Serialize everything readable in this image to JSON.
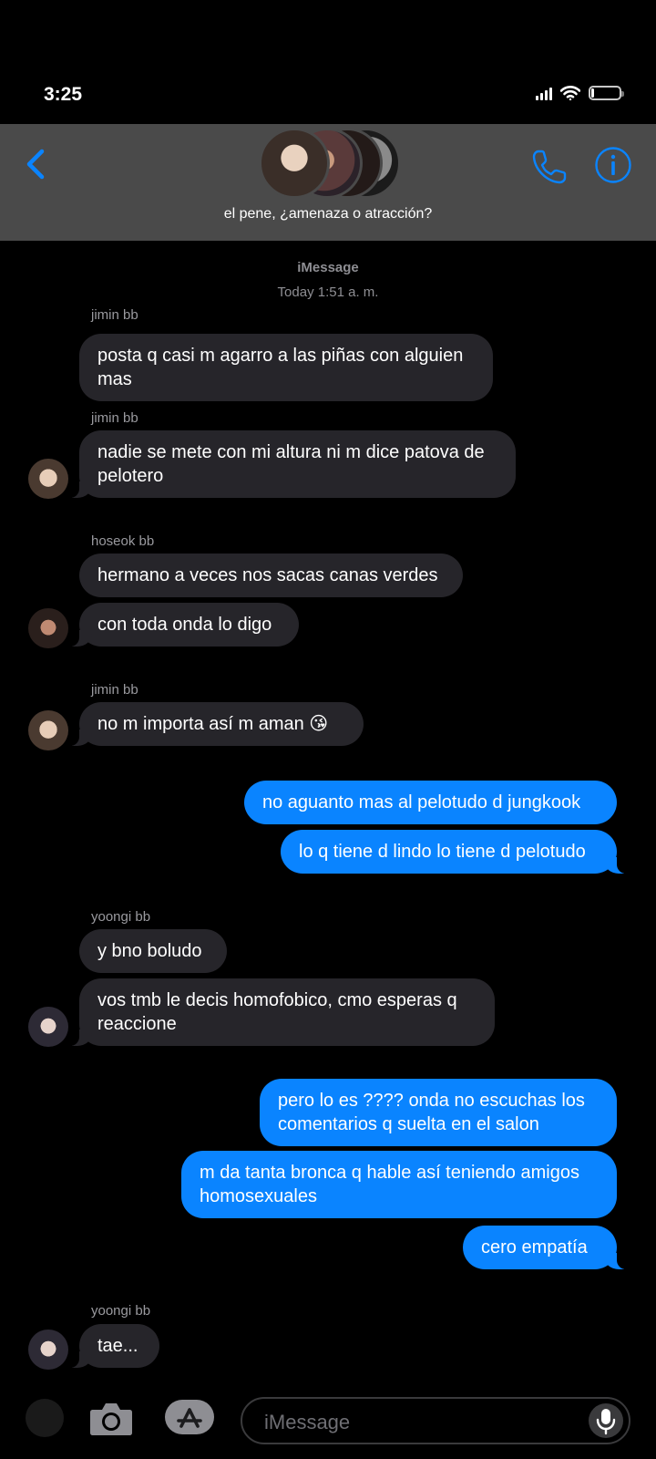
{
  "status": {
    "time": "3:25"
  },
  "header": {
    "title": "el pene, ¿amenaza o atracción?"
  },
  "meta": {
    "service": "iMessage",
    "timestamp": "Today 1:51 a. m."
  },
  "senders": [
    "jimin bb",
    "jimin bb",
    "hoseok bb",
    "jimin bb",
    "yoongi bb",
    "yoongi bb"
  ],
  "messages": [
    {
      "from": "jimin bb",
      "text": "posta q casi m agarro a las piñas con alguien mas"
    },
    {
      "from": "jimin bb",
      "text": "nadie se mete con mi altura ni m dice patova de pelotero"
    },
    {
      "from": "hoseok bb",
      "text": "hermano a veces nos sacas canas verdes"
    },
    {
      "from": "hoseok bb",
      "text": "con toda onda lo digo"
    },
    {
      "from": "jimin bb",
      "text": "no m importa así m aman 😘"
    },
    {
      "from": "me",
      "text": "no aguanto mas al pelotudo d jungkook"
    },
    {
      "from": "me",
      "text": "lo q tiene d lindo lo tiene d pelotudo"
    },
    {
      "from": "yoongi bb",
      "text": "y bno boludo"
    },
    {
      "from": "yoongi bb",
      "text": "vos tmb le decis homofobico, cmo esperas q reaccione"
    },
    {
      "from": "me",
      "text": "pero lo es ???? onda no escuchas los comentarios q suelta en el salon"
    },
    {
      "from": "me",
      "text": "m da tanta bronca q hable así teniendo amigos homosexuales"
    },
    {
      "from": "me",
      "text": "cero empatía"
    },
    {
      "from": "yoongi bb",
      "text": "tae..."
    }
  ],
  "compose": {
    "placeholder": "iMessage"
  },
  "colors": {
    "accent": "#0a84ff",
    "incoming_bubble": "#26252a",
    "header_bg": "#4a4a4a"
  }
}
